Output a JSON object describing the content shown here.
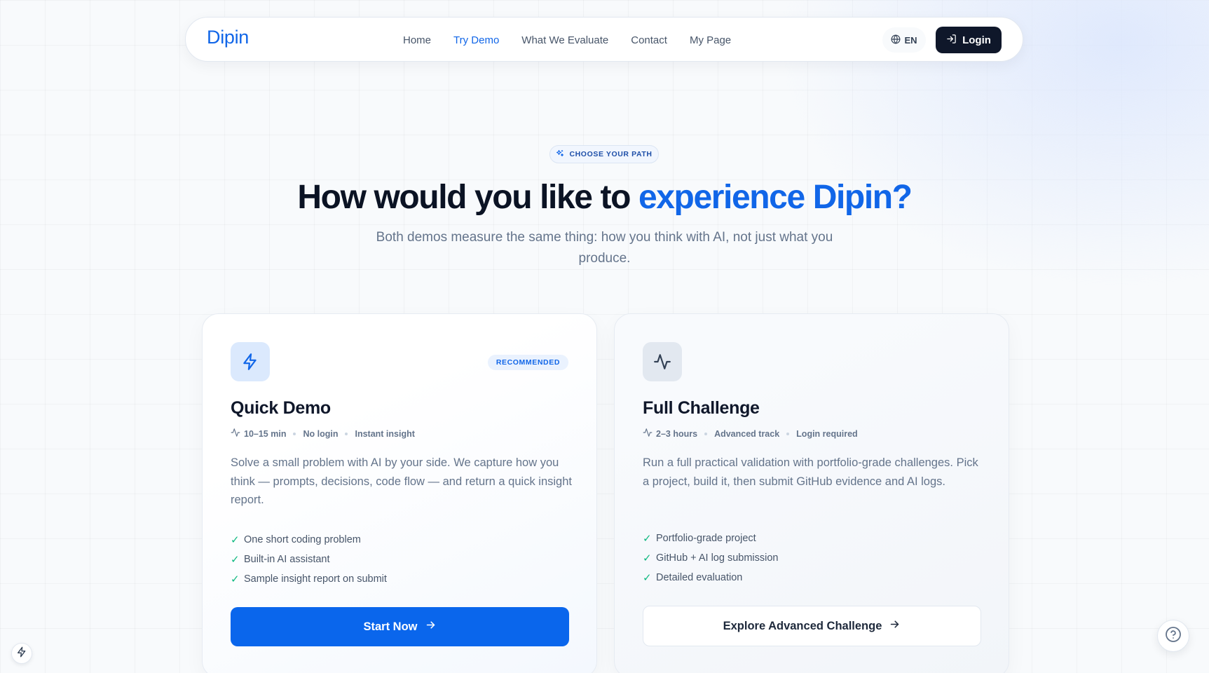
{
  "nav": {
    "brand": "Dipin",
    "links": [
      "Home",
      "Try Demo",
      "What We Evaluate",
      "Contact",
      "My Page"
    ],
    "active_link": "Try Demo",
    "lang_label": "EN",
    "login_label": "Login"
  },
  "hero": {
    "pill": "CHOOSE YOUR PATH",
    "title_prefix": "How would you like to ",
    "title_accent": "experience Dipin?",
    "subtitle": "Both demos measure the same thing: how you think with AI, not just what you produce."
  },
  "cards": {
    "quick": {
      "icon": "lightning-bolt-icon",
      "badge": "RECOMMENDED",
      "title": "Quick Demo",
      "meta": [
        "10–15 min",
        "No login",
        "Instant insight"
      ],
      "description": "Solve a small problem with AI by your side. We capture how you think — prompts, decisions, code flow — and return a quick insight report.",
      "features": [
        "One short coding problem",
        "Built-in AI assistant",
        "Sample insight report on submit"
      ],
      "cta": "Start Now"
    },
    "full": {
      "icon": "activity-pulse-icon",
      "title": "Full Challenge",
      "meta": [
        "2–3 hours",
        "Advanced track",
        "Login required"
      ],
      "description": "Run a full practical validation with portfolio-grade challenges. Pick a project, build it, then submit GitHub evidence and AI logs.",
      "features": [
        "Portfolio-grade project",
        "GitHub + AI log submission",
        "Detailed evaluation"
      ],
      "cta": "Explore Advanced Challenge"
    }
  },
  "colors": {
    "accent": "#1166e8",
    "dark": "#0f172a",
    "check": "#10b981"
  }
}
